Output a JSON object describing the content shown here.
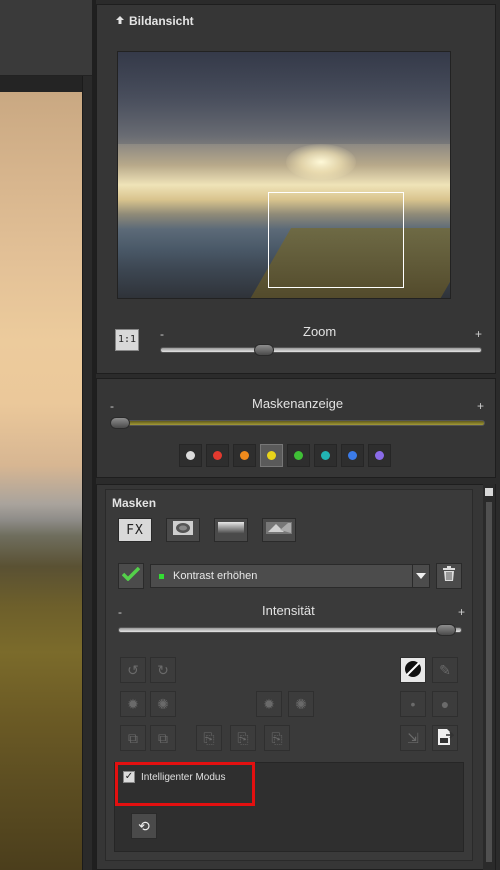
{
  "preview": {
    "title": "Bildansicht",
    "zoom_label": "Zoom",
    "zoom_minus": "-",
    "zoom_plus": "+",
    "one_to_one": "1:1",
    "zoom_level_fraction": 0.31
  },
  "mask_display": {
    "label": "Maskenanzeige",
    "minus": "-",
    "plus": "+",
    "level_fraction": 0.0,
    "colors": [
      {
        "name": "white",
        "hex": "#dcdcdc"
      },
      {
        "name": "red",
        "hex": "#e33a2f"
      },
      {
        "name": "orange",
        "hex": "#ef8a1c"
      },
      {
        "name": "yellow",
        "hex": "#e8d31a"
      },
      {
        "name": "green",
        "hex": "#3fbf36"
      },
      {
        "name": "teal",
        "hex": "#22b3b3"
      },
      {
        "name": "blue",
        "hex": "#3b7be8"
      },
      {
        "name": "purple",
        "hex": "#8a6be8"
      }
    ],
    "selected_color": "yellow"
  },
  "masks": {
    "title": "Masken",
    "fx_label": "FX",
    "effect": "Kontrast erhöhen",
    "intensity_label": "Intensität",
    "intensity_minus": "-",
    "intensity_plus": "+",
    "intensity_fraction": 0.98,
    "smart_mode_label": "Intelligenter Modus",
    "smart_mode_checked": true
  }
}
